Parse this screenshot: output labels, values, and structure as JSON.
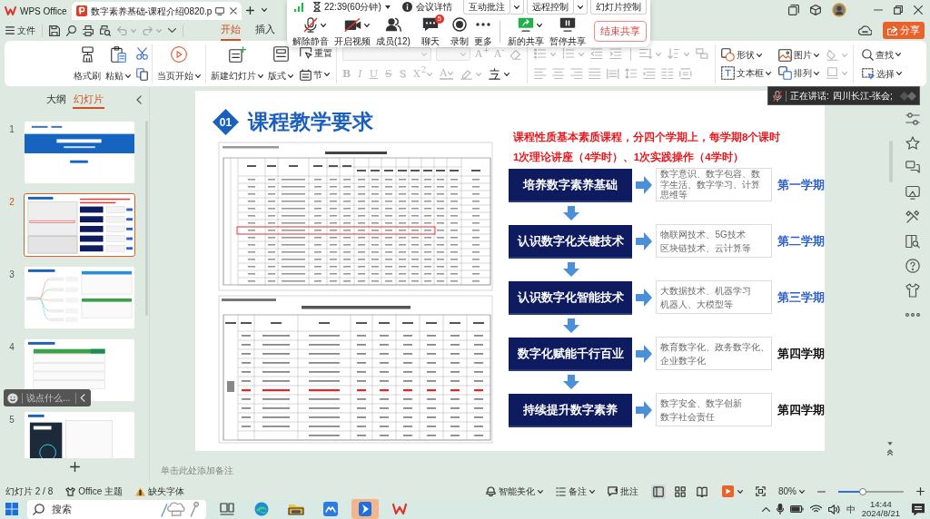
{
  "title_bar": {
    "tabs": [
      {
        "kind": "home",
        "label": "WPS Office",
        "selected": false
      },
      {
        "kind": "document",
        "label": "数字素养基础-课程介绍0820.p",
        "selected": true
      }
    ]
  },
  "menu_bar": {
    "file": "文件",
    "tabs": [
      {
        "label": "开始",
        "selected": true
      },
      {
        "label": "插入",
        "selected": false
      }
    ],
    "share_button": "分享"
  },
  "ribbon": {
    "clipboard": [
      {
        "label": "格式刷",
        "dropdown": false
      },
      {
        "label": "粘贴",
        "dropdown": true
      }
    ],
    "slideshow": [
      {
        "label": "当页开始",
        "dropdown": true
      }
    ],
    "slides": [
      {
        "label": "新建幻灯片",
        "dropdown": true
      },
      {
        "label": "版式",
        "dropdown": true
      }
    ],
    "slide_tools": [
      {
        "label": "重置",
        "dropdown": false
      },
      {
        "label": "节",
        "dropdown": true
      }
    ],
    "font_fields": [
      {
        "disabled": true
      },
      {
        "disabled": true
      }
    ],
    "font_size": [
      {
        "label": "A$^{+}$",
        "disabled": true
      },
      {
        "label": "A$^{-}$",
        "disabled": true
      }
    ],
    "font_styles": [
      {
        "label": "B",
        "dropdown": false,
        "disabled": true
      },
      {
        "label": "I",
        "dropdown": false,
        "disabled": true
      },
      {
        "label": "U",
        "dropdown": false,
        "disabled": true
      },
      {
        "label": "S",
        "dropdown": false,
        "disabled": true
      },
      {
        "label": "S",
        "dropdown": false,
        "disabled": true
      },
      {
        "label": "X$^{2}$",
        "dropdown": true,
        "disabled": true
      },
      {
        "label": "A",
        "dropdown": true,
        "disabled": true
      }
    ],
    "insert": [
      {
        "label": "形状",
        "dropdown": true
      },
      {
        "label": "图片",
        "dropdown": true
      },
      {
        "label": "文本框",
        "dropdown": true
      },
      {
        "label": "排列",
        "dropdown": true
      }
    ],
    "editing": [
      {
        "label": "查找",
        "dropdown": true
      },
      {
        "label": "选择",
        "dropdown": true
      }
    ]
  },
  "meeting_bar": {
    "timer": "22:39(60分钟)",
    "details": "会议详情",
    "top_buttons": [
      {
        "label": "互动批注",
        "dropdown": true
      },
      {
        "label": "远程控制",
        "dropdown": true
      },
      {
        "label": "幻灯片控制",
        "dropdown": false
      }
    ],
    "controls": [
      {
        "label": "解除静音",
        "dropdown": true
      },
      {
        "label": "开启视频",
        "dropdown": true
      },
      {
        "label": "成员(12)",
        "dropdown": false
      },
      {
        "label": "聊天",
        "dropdown": false,
        "badge": "5"
      },
      {
        "label": "录制",
        "dropdown": false
      },
      {
        "label": "更多",
        "dropdown": false
      }
    ],
    "share_controls": [
      {
        "label": "新的共享",
        "dropdown": true
      },
      {
        "label": "暂停共享",
        "dropdown": false
      }
    ],
    "end_button": "结束共享"
  },
  "speaker_banner": {
    "label": "正在讲话:",
    "name": "四川长江-张会;"
  },
  "slide_panel": {
    "tabs": [
      {
        "label": "大纲",
        "selected": false
      },
      {
        "label": "幻灯片",
        "selected": true
      }
    ],
    "thumbnails": [
      {
        "number": "1",
        "kind": "title",
        "selected": false
      },
      {
        "number": "2",
        "kind": "flow",
        "selected": true
      },
      {
        "number": "3",
        "kind": "mindmap",
        "selected": false
      },
      {
        "number": "4",
        "kind": "table",
        "selected": false
      },
      {
        "number": "5",
        "kind": "book",
        "selected": false
      }
    ],
    "chat_placeholder": "说点什么..."
  },
  "slide": {
    "number": "01",
    "title": "课程教学要求",
    "intro": [
      "课程性质基本素质课程，分四个学期上，每学期8个课时",
      "1次理论讲座（4学时）、1次实践操作（4学时）"
    ],
    "steps": [
      {
        "label": "培养数字素养基础",
        "details": [
          "数字意识、数字包容、数",
          "字生活、数字学习、计算",
          "思维等"
        ],
        "term": "第一学期",
        "color": "#2e5fcf"
      },
      {
        "label": "认识数字化关键技术",
        "details": [
          "物联网技术、5G技术",
          "区块链技术、云计算等"
        ],
        "term": "第二学期",
        "color": "#2e5fcf"
      },
      {
        "label": "认识数字化智能技术",
        "details": [
          "大数据技术、机器学习",
          "机器人、大模型等"
        ],
        "term": "第三学期",
        "color": "#2e5fcf"
      },
      {
        "label": "数字化赋能千行百业",
        "details": [
          "教育数字化、政务数字化、",
          "企业数字化"
        ],
        "term": "第四学期",
        "color": "#111111"
      },
      {
        "label": "持续提升数字素养",
        "details": [
          "数字安全、数字创新",
          "数字社会责任"
        ],
        "term": "第四学期",
        "color": "#111111"
      }
    ]
  },
  "notes_placeholder": "单击此处添加备注",
  "status_bar": {
    "slide_count": "幻灯片 2 / 8",
    "theme": "Office 主题",
    "missing_fonts": "缺失字体",
    "beautify": "智能美化",
    "notes": "备注",
    "comments": "批注",
    "views": [
      {
        "selected": true
      },
      {
        "selected": false
      },
      {
        "selected": false
      }
    ],
    "zoom": "80%",
    "zoom_slider": {
      "level": 0.38
    }
  },
  "taskbar": {
    "search_placeholder": "搜索",
    "apps": [
      {
        "selected": false
      },
      {
        "selected": false
      },
      {
        "selected": false
      },
      {
        "selected": false
      },
      {
        "selected": true
      },
      {
        "selected": false
      }
    ],
    "input_method": "中",
    "time": "14:44",
    "date": "2024/8/21"
  }
}
